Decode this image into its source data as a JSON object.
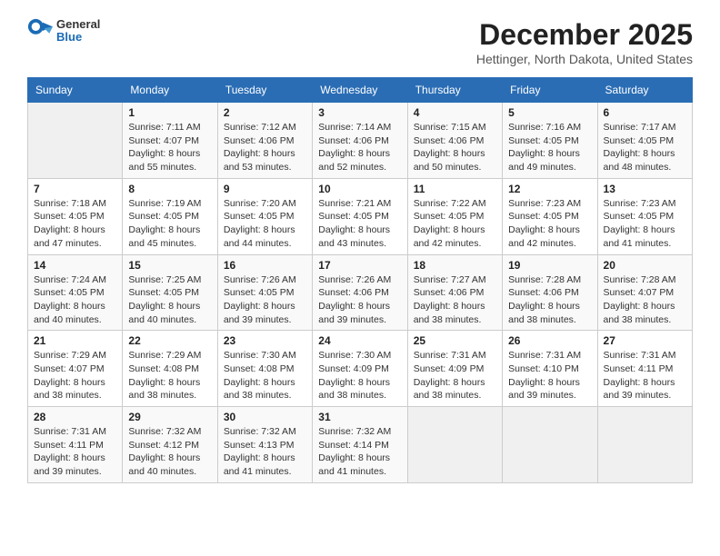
{
  "header": {
    "logo_general": "General",
    "logo_blue": "Blue",
    "title": "December 2025",
    "location": "Hettinger, North Dakota, United States"
  },
  "calendar": {
    "days_of_week": [
      "Sunday",
      "Monday",
      "Tuesday",
      "Wednesday",
      "Thursday",
      "Friday",
      "Saturday"
    ],
    "weeks": [
      [
        {
          "day": "",
          "info": ""
        },
        {
          "day": "1",
          "info": "Sunrise: 7:11 AM\nSunset: 4:07 PM\nDaylight: 8 hours\nand 55 minutes."
        },
        {
          "day": "2",
          "info": "Sunrise: 7:12 AM\nSunset: 4:06 PM\nDaylight: 8 hours\nand 53 minutes."
        },
        {
          "day": "3",
          "info": "Sunrise: 7:14 AM\nSunset: 4:06 PM\nDaylight: 8 hours\nand 52 minutes."
        },
        {
          "day": "4",
          "info": "Sunrise: 7:15 AM\nSunset: 4:06 PM\nDaylight: 8 hours\nand 50 minutes."
        },
        {
          "day": "5",
          "info": "Sunrise: 7:16 AM\nSunset: 4:05 PM\nDaylight: 8 hours\nand 49 minutes."
        },
        {
          "day": "6",
          "info": "Sunrise: 7:17 AM\nSunset: 4:05 PM\nDaylight: 8 hours\nand 48 minutes."
        }
      ],
      [
        {
          "day": "7",
          "info": "Sunrise: 7:18 AM\nSunset: 4:05 PM\nDaylight: 8 hours\nand 47 minutes."
        },
        {
          "day": "8",
          "info": "Sunrise: 7:19 AM\nSunset: 4:05 PM\nDaylight: 8 hours\nand 45 minutes."
        },
        {
          "day": "9",
          "info": "Sunrise: 7:20 AM\nSunset: 4:05 PM\nDaylight: 8 hours\nand 44 minutes."
        },
        {
          "day": "10",
          "info": "Sunrise: 7:21 AM\nSunset: 4:05 PM\nDaylight: 8 hours\nand 43 minutes."
        },
        {
          "day": "11",
          "info": "Sunrise: 7:22 AM\nSunset: 4:05 PM\nDaylight: 8 hours\nand 42 minutes."
        },
        {
          "day": "12",
          "info": "Sunrise: 7:23 AM\nSunset: 4:05 PM\nDaylight: 8 hours\nand 42 minutes."
        },
        {
          "day": "13",
          "info": "Sunrise: 7:23 AM\nSunset: 4:05 PM\nDaylight: 8 hours\nand 41 minutes."
        }
      ],
      [
        {
          "day": "14",
          "info": "Sunrise: 7:24 AM\nSunset: 4:05 PM\nDaylight: 8 hours\nand 40 minutes."
        },
        {
          "day": "15",
          "info": "Sunrise: 7:25 AM\nSunset: 4:05 PM\nDaylight: 8 hours\nand 40 minutes."
        },
        {
          "day": "16",
          "info": "Sunrise: 7:26 AM\nSunset: 4:05 PM\nDaylight: 8 hours\nand 39 minutes."
        },
        {
          "day": "17",
          "info": "Sunrise: 7:26 AM\nSunset: 4:06 PM\nDaylight: 8 hours\nand 39 minutes."
        },
        {
          "day": "18",
          "info": "Sunrise: 7:27 AM\nSunset: 4:06 PM\nDaylight: 8 hours\nand 38 minutes."
        },
        {
          "day": "19",
          "info": "Sunrise: 7:28 AM\nSunset: 4:06 PM\nDaylight: 8 hours\nand 38 minutes."
        },
        {
          "day": "20",
          "info": "Sunrise: 7:28 AM\nSunset: 4:07 PM\nDaylight: 8 hours\nand 38 minutes."
        }
      ],
      [
        {
          "day": "21",
          "info": "Sunrise: 7:29 AM\nSunset: 4:07 PM\nDaylight: 8 hours\nand 38 minutes."
        },
        {
          "day": "22",
          "info": "Sunrise: 7:29 AM\nSunset: 4:08 PM\nDaylight: 8 hours\nand 38 minutes."
        },
        {
          "day": "23",
          "info": "Sunrise: 7:30 AM\nSunset: 4:08 PM\nDaylight: 8 hours\nand 38 minutes."
        },
        {
          "day": "24",
          "info": "Sunrise: 7:30 AM\nSunset: 4:09 PM\nDaylight: 8 hours\nand 38 minutes."
        },
        {
          "day": "25",
          "info": "Sunrise: 7:31 AM\nSunset: 4:09 PM\nDaylight: 8 hours\nand 38 minutes."
        },
        {
          "day": "26",
          "info": "Sunrise: 7:31 AM\nSunset: 4:10 PM\nDaylight: 8 hours\nand 39 minutes."
        },
        {
          "day": "27",
          "info": "Sunrise: 7:31 AM\nSunset: 4:11 PM\nDaylight: 8 hours\nand 39 minutes."
        }
      ],
      [
        {
          "day": "28",
          "info": "Sunrise: 7:31 AM\nSunset: 4:11 PM\nDaylight: 8 hours\nand 39 minutes."
        },
        {
          "day": "29",
          "info": "Sunrise: 7:32 AM\nSunset: 4:12 PM\nDaylight: 8 hours\nand 40 minutes."
        },
        {
          "day": "30",
          "info": "Sunrise: 7:32 AM\nSunset: 4:13 PM\nDaylight: 8 hours\nand 41 minutes."
        },
        {
          "day": "31",
          "info": "Sunrise: 7:32 AM\nSunset: 4:14 PM\nDaylight: 8 hours\nand 41 minutes."
        },
        {
          "day": "",
          "info": ""
        },
        {
          "day": "",
          "info": ""
        },
        {
          "day": "",
          "info": ""
        }
      ]
    ]
  }
}
